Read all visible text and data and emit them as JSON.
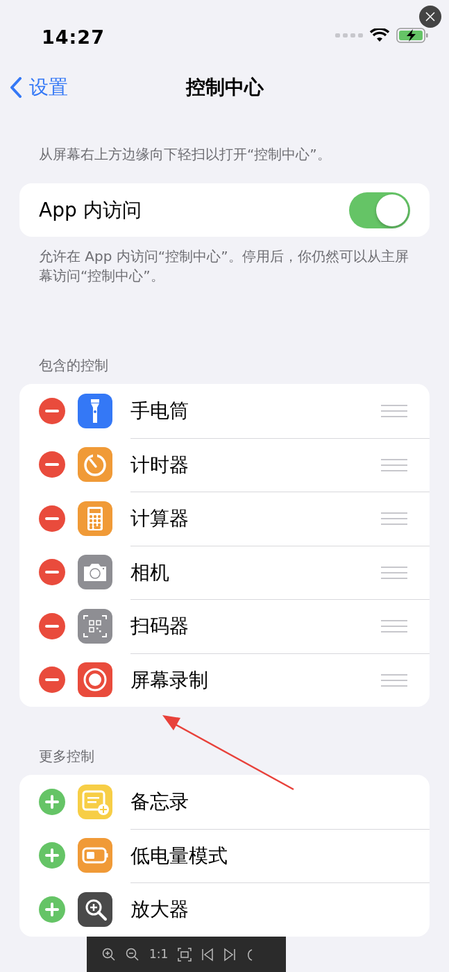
{
  "status_bar": {
    "time": "14:27"
  },
  "nav": {
    "back": "设置",
    "title": "控制中心"
  },
  "intro": "从屏幕右上方边缘向下轻扫以打开“控制中心”。",
  "app_access": {
    "label": "App 内访问",
    "on": true,
    "note": "允许在 App 内访问“控制中心”。停用后，你仍然可以从主屏幕访问“控制中心”。"
  },
  "sections": [
    {
      "header": "包含的控制",
      "kind": "included",
      "items": [
        {
          "label": "手电筒",
          "color": "#3478f6"
        },
        {
          "label": "计时器",
          "color": "#f09a37"
        },
        {
          "label": "计算器",
          "color": "#f09a37"
        },
        {
          "label": "相机",
          "color": "#8e8e93"
        },
        {
          "label": "扫码器",
          "color": "#8e8e93"
        },
        {
          "label": "屏幕录制",
          "color": "#e94b3c"
        }
      ]
    },
    {
      "header": "更多控制",
      "kind": "more",
      "items": [
        {
          "label": "备忘录",
          "color": "#f7ce46"
        },
        {
          "label": "低电量模式",
          "color": "#f09a37"
        },
        {
          "label": "放大器",
          "color": "#4a4a4a"
        }
      ]
    }
  ],
  "viewer_toolbar": {
    "zoom_label": "1:1"
  }
}
